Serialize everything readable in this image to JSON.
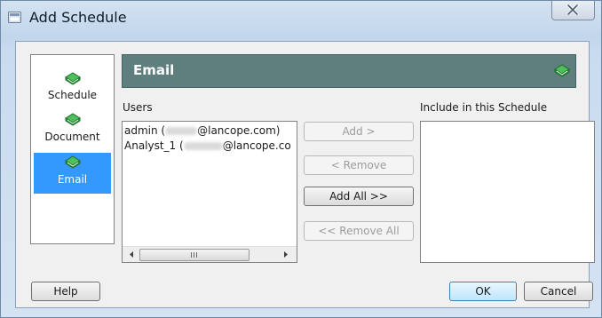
{
  "window": {
    "title": "Add Schedule"
  },
  "nav": {
    "items": [
      {
        "label": "Schedule",
        "icon": "book-icon",
        "selected": false
      },
      {
        "label": "Document",
        "icon": "book-icon",
        "selected": false
      },
      {
        "label": "Email",
        "icon": "book-icon",
        "selected": true
      }
    ]
  },
  "section": {
    "title": "Email",
    "icon": "book-icon"
  },
  "users": {
    "label": "Users",
    "items": [
      {
        "prefix": "admin (",
        "suffix": "@lancope.com)"
      },
      {
        "prefix": "Analyst_1 (",
        "suffix": "@lancope.co"
      }
    ]
  },
  "include": {
    "label": "Include in this Schedule",
    "items": []
  },
  "buttons": {
    "add": "Add >",
    "remove": "< Remove",
    "add_all": "Add All >>",
    "remove_all": "<< Remove All",
    "help": "Help",
    "ok": "OK",
    "cancel": "Cancel"
  },
  "colors": {
    "header_bg": "#5f7f7f",
    "selected_bg": "#3399ff",
    "book_green": "#2e9a3e"
  }
}
